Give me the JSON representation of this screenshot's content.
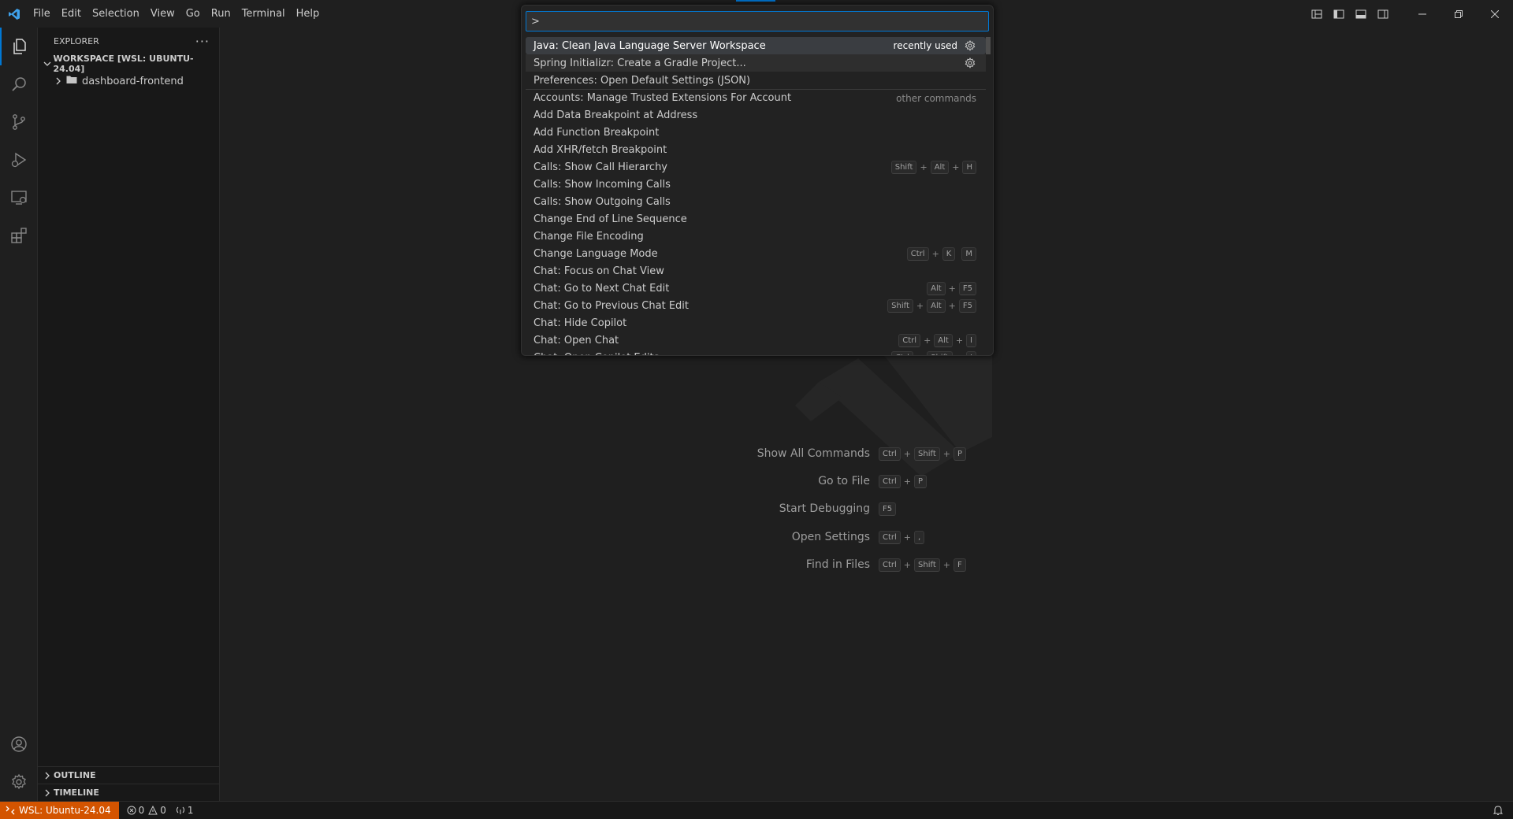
{
  "colors": {
    "accent": "#0078d4",
    "remote_bg": "#d35400",
    "background": "#1f1f1f",
    "sidebar_bg": "#181818"
  },
  "titlebar": {
    "menu": [
      "File",
      "Edit",
      "Selection",
      "View",
      "Go",
      "Run",
      "Terminal",
      "Help"
    ],
    "layout_icons": [
      "customize-layout-icon",
      "toggle-primary-sidebar-icon",
      "toggle-panel-icon",
      "toggle-secondary-sidebar-icon"
    ],
    "window_controls": [
      "minimize-icon",
      "restore-icon",
      "close-icon"
    ]
  },
  "activitybar": {
    "items": [
      "explorer-icon",
      "search-icon",
      "source-control-icon",
      "run-debug-icon",
      "remote-explorer-icon",
      "extensions-icon"
    ],
    "bottom": [
      "accounts-icon",
      "manage-gear-icon"
    ]
  },
  "sidebar": {
    "title": "EXPLORER",
    "more_actions": "···",
    "workspace_label": "WORKSPACE [WSL: UBUNTU-24.04]",
    "folder": "dashboard-frontend",
    "outline_label": "OUTLINE",
    "timeline_label": "TIMELINE"
  },
  "palette": {
    "input_value": ">",
    "items": [
      {
        "label": "Java: Clean Java Language Server Workspace",
        "desc": "recently used",
        "gear": true,
        "state": "selected"
      },
      {
        "label": "Spring Initializr: Create a Gradle Project...",
        "desc": "",
        "gear": true,
        "state": "recent"
      },
      {
        "label": "Preferences: Open Default Settings (JSON)",
        "desc": "",
        "gear": false
      },
      {
        "label": "Accounts: Manage Trusted Extensions For Account",
        "group": "other commands",
        "sep": true
      },
      {
        "label": "Add Data Breakpoint at Address"
      },
      {
        "label": "Add Function Breakpoint"
      },
      {
        "label": "Add XHR/fetch Breakpoint"
      },
      {
        "label": "Calls: Show Call Hierarchy",
        "keys": [
          [
            "Shift",
            "Alt",
            "H"
          ]
        ]
      },
      {
        "label": "Calls: Show Incoming Calls"
      },
      {
        "label": "Calls: Show Outgoing Calls"
      },
      {
        "label": "Change End of Line Sequence"
      },
      {
        "label": "Change File Encoding"
      },
      {
        "label": "Change Language Mode",
        "keys": [
          [
            "Ctrl",
            "K"
          ],
          [
            "M"
          ]
        ]
      },
      {
        "label": "Chat: Focus on Chat View"
      },
      {
        "label": "Chat: Go to Next Chat Edit",
        "keys": [
          [
            "Alt",
            "F5"
          ]
        ]
      },
      {
        "label": "Chat: Go to Previous Chat Edit",
        "keys": [
          [
            "Shift",
            "Alt",
            "F5"
          ]
        ]
      },
      {
        "label": "Chat: Hide Copilot"
      },
      {
        "label": "Chat: Open Chat",
        "keys": [
          [
            "Ctrl",
            "Alt",
            "I"
          ]
        ]
      },
      {
        "label": "Chat: Open Copilot Edits",
        "keys": [
          [
            "Ctrl",
            "Shift",
            "I"
          ]
        ]
      }
    ]
  },
  "editor": {
    "shortcuts": [
      {
        "label": "Show All Commands",
        "keys": [
          "Ctrl",
          "Shift",
          "P"
        ]
      },
      {
        "label": "Go to File",
        "keys": [
          "Ctrl",
          "P"
        ]
      },
      {
        "label": "Start Debugging",
        "keys": [
          "F5"
        ]
      },
      {
        "label": "Open Settings",
        "keys": [
          "Ctrl",
          ","
        ]
      },
      {
        "label": "Find in Files",
        "keys": [
          "Ctrl",
          "Shift",
          "F"
        ]
      }
    ]
  },
  "statusbar": {
    "remote": "WSL: Ubuntu-24.04",
    "errors": "0",
    "warnings": "0",
    "ports": "1"
  }
}
